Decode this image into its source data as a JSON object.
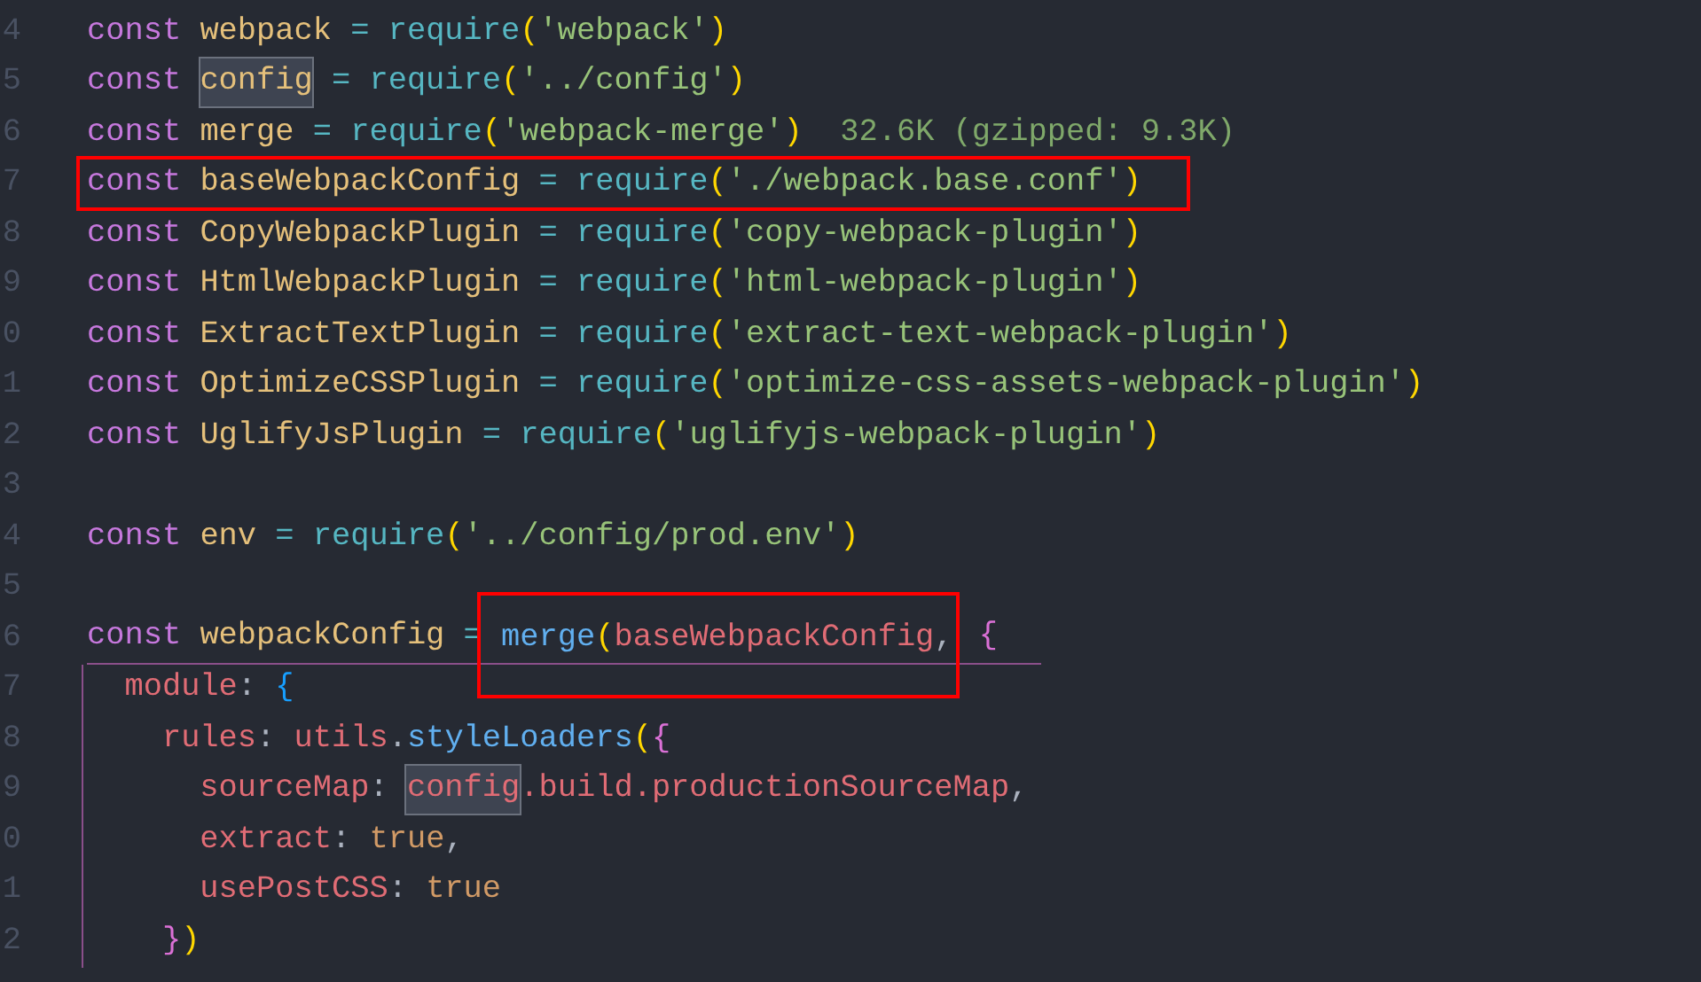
{
  "editor": {
    "lines": [
      {
        "number": "4",
        "tokens": [
          {
            "text": "const ",
            "kind": "keyword"
          },
          {
            "text": "webpack",
            "kind": "variable"
          },
          {
            "text": " = ",
            "kind": "operator"
          },
          {
            "text": "require",
            "kind": "function"
          },
          {
            "text": "(",
            "kind": "bracket1"
          },
          {
            "text": "'webpack'",
            "kind": "string"
          },
          {
            "text": ")",
            "kind": "bracket1"
          }
        ]
      },
      {
        "number": "5",
        "tokens": [
          {
            "text": "const ",
            "kind": "keyword"
          },
          {
            "text": "config",
            "kind": "variable",
            "highlighted": true
          },
          {
            "text": " = ",
            "kind": "operator"
          },
          {
            "text": "require",
            "kind": "function"
          },
          {
            "text": "(",
            "kind": "bracket1"
          },
          {
            "text": "'../config'",
            "kind": "string"
          },
          {
            "text": ")",
            "kind": "bracket1"
          }
        ]
      },
      {
        "number": "6",
        "tokens": [
          {
            "text": "const ",
            "kind": "keyword"
          },
          {
            "text": "merge",
            "kind": "variable"
          },
          {
            "text": " = ",
            "kind": "operator"
          },
          {
            "text": "require",
            "kind": "function"
          },
          {
            "text": "(",
            "kind": "bracket1"
          },
          {
            "text": "'webpack-merge'",
            "kind": "string"
          },
          {
            "text": ")",
            "kind": "bracket1"
          },
          {
            "text": "32.6K (gzipped: 9.3K)",
            "kind": "hint"
          }
        ]
      },
      {
        "number": "7",
        "tokens": [
          {
            "kind": "box",
            "tokens": [
              {
                "text": "const ",
                "kind": "keyword"
              },
              {
                "text": "baseWebpackConfig",
                "kind": "variable"
              },
              {
                "text": " = ",
                "kind": "operator"
              },
              {
                "text": "require",
                "kind": "function"
              },
              {
                "text": "(",
                "kind": "bracket1"
              },
              {
                "text": "'./webpack.base.conf'",
                "kind": "string"
              },
              {
                "text": ")",
                "kind": "bracket1"
              }
            ]
          }
        ]
      },
      {
        "number": "8",
        "tokens": [
          {
            "text": "const ",
            "kind": "keyword"
          },
          {
            "text": "CopyWebpackPlugin",
            "kind": "variable"
          },
          {
            "text": " = ",
            "kind": "operator"
          },
          {
            "text": "require",
            "kind": "function"
          },
          {
            "text": "(",
            "kind": "bracket1"
          },
          {
            "text": "'copy-webpack-plugin'",
            "kind": "string"
          },
          {
            "text": ")",
            "kind": "bracket1"
          }
        ]
      },
      {
        "number": "9",
        "tokens": [
          {
            "text": "const ",
            "kind": "keyword"
          },
          {
            "text": "HtmlWebpackPlugin",
            "kind": "variable"
          },
          {
            "text": " = ",
            "kind": "operator"
          },
          {
            "text": "require",
            "kind": "function"
          },
          {
            "text": "(",
            "kind": "bracket1"
          },
          {
            "text": "'html-webpack-plugin'",
            "kind": "string"
          },
          {
            "text": ")",
            "kind": "bracket1"
          }
        ]
      },
      {
        "number": "0",
        "tokens": [
          {
            "text": "const ",
            "kind": "keyword"
          },
          {
            "text": "ExtractTextPlugin",
            "kind": "variable"
          },
          {
            "text": " = ",
            "kind": "operator"
          },
          {
            "text": "require",
            "kind": "function"
          },
          {
            "text": "(",
            "kind": "bracket1"
          },
          {
            "text": "'extract-text-webpack-plugin'",
            "kind": "string"
          },
          {
            "text": ")",
            "kind": "bracket1"
          }
        ]
      },
      {
        "number": "1",
        "tokens": [
          {
            "text": "const ",
            "kind": "keyword"
          },
          {
            "text": "OptimizeCSSPlugin",
            "kind": "variable"
          },
          {
            "text": " = ",
            "kind": "operator"
          },
          {
            "text": "require",
            "kind": "function"
          },
          {
            "text": "(",
            "kind": "bracket1"
          },
          {
            "text": "'optimize-css-assets-webpack-plugin'",
            "kind": "string"
          },
          {
            "text": ")",
            "kind": "bracket1"
          }
        ]
      },
      {
        "number": "2",
        "tokens": [
          {
            "text": "const ",
            "kind": "keyword"
          },
          {
            "text": "UglifyJsPlugin",
            "kind": "variable"
          },
          {
            "text": " = ",
            "kind": "operator"
          },
          {
            "text": "require",
            "kind": "function"
          },
          {
            "text": "(",
            "kind": "bracket1"
          },
          {
            "text": "'uglifyjs-webpack-plugin'",
            "kind": "string"
          },
          {
            "text": ")",
            "kind": "bracket1"
          }
        ]
      },
      {
        "number": "3"
      },
      {
        "number": "4",
        "tokens": [
          {
            "text": "const ",
            "kind": "keyword"
          },
          {
            "text": "env",
            "kind": "variable"
          },
          {
            "text": " = ",
            "kind": "operator"
          },
          {
            "text": "require",
            "kind": "function"
          },
          {
            "text": "(",
            "kind": "bracket1"
          },
          {
            "text": "'../config/prod.env'",
            "kind": "string"
          },
          {
            "text": ")",
            "kind": "bracket1"
          }
        ]
      },
      {
        "number": "5"
      },
      {
        "number": "6",
        "scope_start": true,
        "tokens": [
          {
            "text": "const ",
            "kind": "keyword"
          },
          {
            "text": "webpackConfig",
            "kind": "variable"
          },
          {
            "text": " = ",
            "kind": "operator"
          },
          {
            "kind": "tall_box",
            "tokens": [
              {
                "text": "merge",
                "kind": "method"
              },
              {
                "text": "(",
                "kind": "bracket1"
              },
              {
                "text": "baseWebpackConfig",
                "kind": "property"
              },
              {
                "text": ",",
                "kind": "punct"
              }
            ]
          },
          {
            "text": "{",
            "kind": "bracket2"
          }
        ]
      },
      {
        "number": "7",
        "in_scope": true,
        "tokens": [
          {
            "text": "  module",
            "kind": "property"
          },
          {
            "text": ": ",
            "kind": "punct"
          },
          {
            "text": "{",
            "kind": "bracket3"
          }
        ]
      },
      {
        "number": "8",
        "in_scope": true,
        "tokens": [
          {
            "text": "    rules",
            "kind": "property"
          },
          {
            "text": ": ",
            "kind": "punct"
          },
          {
            "text": "utils",
            "kind": "property"
          },
          {
            "text": ".",
            "kind": "punct"
          },
          {
            "text": "styleLoaders",
            "kind": "method"
          },
          {
            "text": "(",
            "kind": "bracket1"
          },
          {
            "text": "{",
            "kind": "bracket2"
          }
        ]
      },
      {
        "number": "9",
        "in_scope": true,
        "tokens": [
          {
            "text": "      sourceMap",
            "kind": "property"
          },
          {
            "text": ": ",
            "kind": "punct"
          },
          {
            "text": "config",
            "kind": "property",
            "highlighted": true
          },
          {
            "text": ".build.productionSourceMap",
            "kind": "property"
          },
          {
            "text": ",",
            "kind": "punct"
          }
        ]
      },
      {
        "number": "0",
        "in_scope": true,
        "tokens": [
          {
            "text": "      extract",
            "kind": "property"
          },
          {
            "text": ": ",
            "kind": "punct"
          },
          {
            "text": "true",
            "kind": "literal"
          },
          {
            "text": ",",
            "kind": "punct"
          }
        ]
      },
      {
        "number": "1",
        "in_scope": true,
        "tokens": [
          {
            "text": "      usePostCSS",
            "kind": "property"
          },
          {
            "text": ": ",
            "kind": "punct"
          },
          {
            "text": "true",
            "kind": "literal"
          }
        ]
      },
      {
        "number": "2",
        "in_scope": true,
        "tokens": [
          {
            "text": "    }",
            "kind": "bracket2"
          },
          {
            "text": ")",
            "kind": "bracket1"
          }
        ]
      }
    ]
  }
}
